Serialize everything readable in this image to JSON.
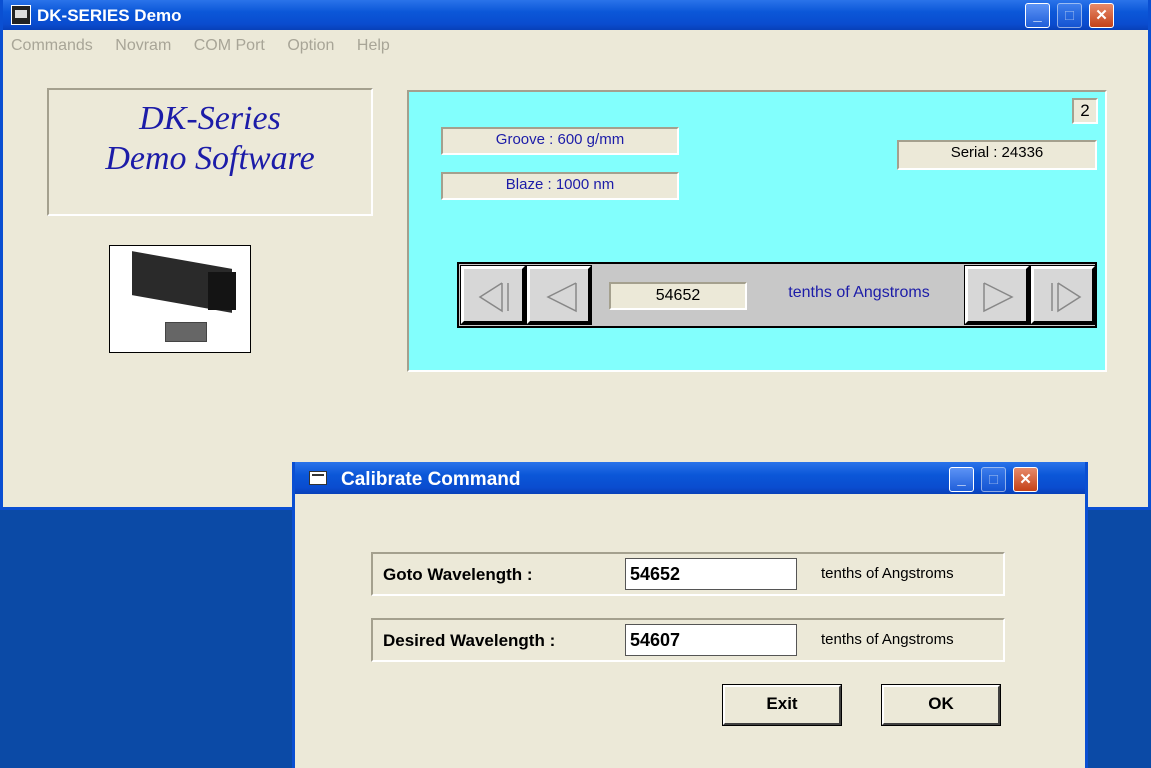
{
  "main_window": {
    "title": "DK-SERIES Demo",
    "menu": [
      "Commands",
      "Novram",
      "COM Port",
      "Option",
      "Help"
    ],
    "brand_line1": "DK-Series",
    "brand_line2": "Demo Software",
    "groove": "Groove : 600 g/mm",
    "blaze": "Blaze : 1000 nm",
    "serial": "Serial : 24336",
    "slot_number": "2",
    "position_value": "54652",
    "position_units": "tenths of Angstroms",
    "min_button_glyph": "_",
    "max_button_glyph": "□",
    "close_button_glyph": "✕"
  },
  "dialog": {
    "title": "Calibrate Command",
    "goto_label": "Goto Wavelength :",
    "goto_value": "54652",
    "goto_units": "tenths of Angstroms",
    "desired_label": "Desired Wavelength :",
    "desired_value": "54607",
    "desired_units": "tenths of Angstroms",
    "exit_label": "Exit",
    "ok_label": "OK"
  },
  "colors": {
    "panel_cyan": "#82fffd",
    "label_blue": "#1c1ca8",
    "titlebar_blue": "#0b57d8",
    "desktop": "#0b4aa6"
  }
}
